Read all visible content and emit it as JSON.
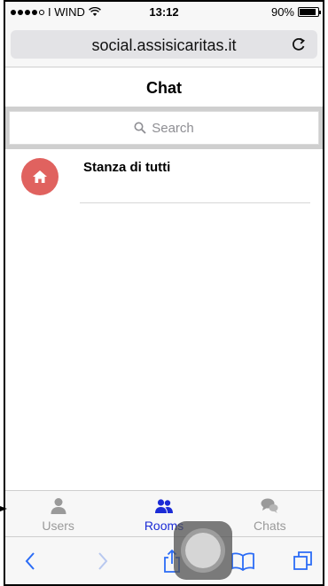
{
  "status_bar": {
    "carrier": "I WIND",
    "time": "13:12",
    "battery_text": "90%",
    "battery_level": 0.9
  },
  "browser": {
    "url": "social.assisicaritas.it"
  },
  "page": {
    "title": "Chat"
  },
  "search": {
    "placeholder": "Search"
  },
  "rooms": [
    {
      "name": "Stanza di tutti",
      "icon": "home-icon",
      "avatar_color": "#e0625f"
    }
  ],
  "tabs": [
    {
      "label": "Users",
      "icon": "user-icon",
      "active": false
    },
    {
      "label": "Rooms",
      "icon": "group-icon",
      "active": true
    },
    {
      "label": "Chats",
      "icon": "chat-bubbles-icon",
      "active": false
    }
  ],
  "colors": {
    "accent": "#1b2bd6",
    "inactive": "#9a9a9a",
    "avatar": "#e0625f",
    "toolbar_icon": "#2b6cf6"
  }
}
